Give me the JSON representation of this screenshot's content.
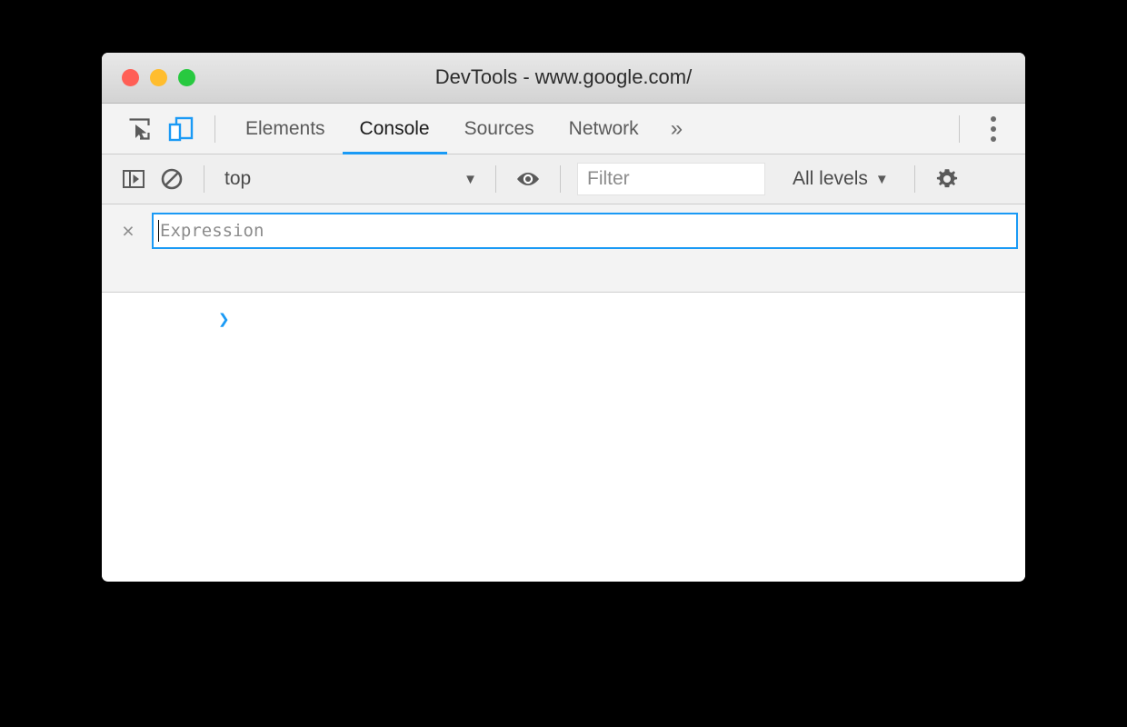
{
  "window": {
    "title": "DevTools - www.google.com/",
    "traffic_lights": [
      {
        "name": "close",
        "color": "#ff5f56"
      },
      {
        "name": "minimize",
        "color": "#ffbd2e"
      },
      {
        "name": "zoom",
        "color": "#28c940"
      }
    ]
  },
  "tabbar": {
    "inspect_icon": "inspect-element-icon",
    "device_icon": "device-toolbar-icon",
    "device_icon_active_color": "#1a9af5",
    "tabs": [
      {
        "label": "Elements",
        "active": false
      },
      {
        "label": "Console",
        "active": true
      },
      {
        "label": "Sources",
        "active": false
      },
      {
        "label": "Network",
        "active": false
      }
    ],
    "more_tabs_label": "»",
    "menu_icon": "kebab-menu-icon",
    "active_underline_color": "#1a9af5"
  },
  "console_toolbar": {
    "sidebar_toggle_icon": "console-sidebar-icon",
    "clear_icon": "clear-console-icon",
    "context": {
      "value": "top",
      "caret": "▼"
    },
    "live_expression_icon": "eye-icon",
    "filter": {
      "placeholder": "Filter",
      "value": ""
    },
    "levels": {
      "label": "All levels",
      "caret": "▼"
    },
    "settings_icon": "gear-icon"
  },
  "live_expression": {
    "remove_label": "×",
    "placeholder": "Expression",
    "value": "",
    "focus_border_color": "#1a9af5"
  },
  "console_body": {
    "prompt_symbol": "❯",
    "prompt_color": "#1a9af5",
    "messages": []
  }
}
